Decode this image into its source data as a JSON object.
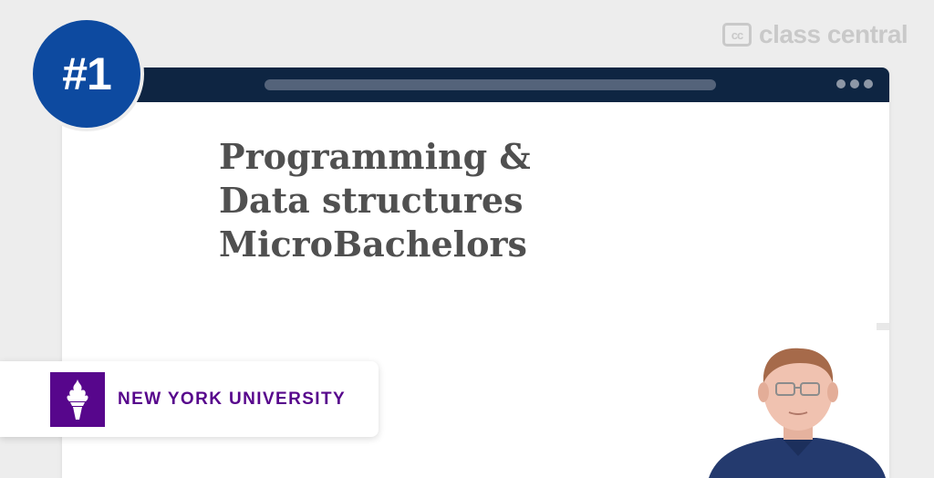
{
  "badge": {
    "rank": "#1"
  },
  "brand": {
    "icon_text": "cc",
    "name": "class central"
  },
  "slide": {
    "title_lines": [
      "Programming &",
      "Data structures",
      "MicroBachelors"
    ]
  },
  "university": {
    "name": "NEW YORK UNIVERSITY",
    "logo_icon": "torch-icon"
  },
  "colors": {
    "badge": "#0d4aa0",
    "titlebar": "#0e2542",
    "nyu_purple": "#57068c",
    "background": "#ededed"
  }
}
